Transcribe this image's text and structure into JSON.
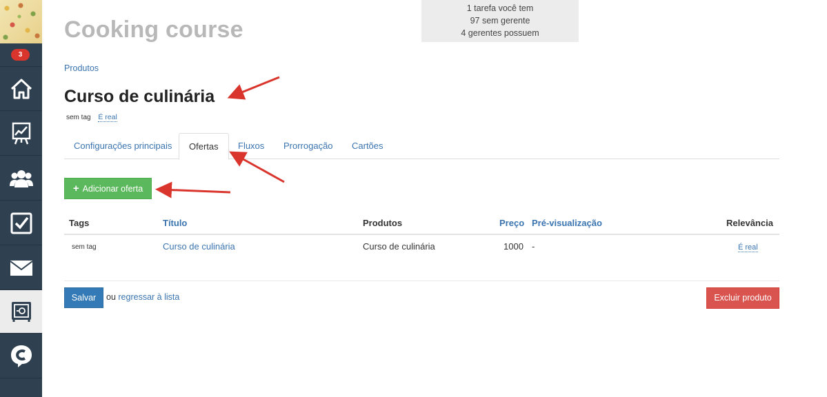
{
  "sidebar": {
    "notification_count": "3",
    "items": [
      {
        "name": "home"
      },
      {
        "name": "stats"
      },
      {
        "name": "users"
      },
      {
        "name": "tasks"
      },
      {
        "name": "mail"
      },
      {
        "name": "products",
        "active": true
      },
      {
        "name": "chat"
      }
    ]
  },
  "info_box": {
    "line1": "1 tarefa você tem",
    "line2": "97 sem gerente",
    "line3": "4 gerentes possuem"
  },
  "header": {
    "course_title": "Cooking course",
    "breadcrumb": "Produtos",
    "page_title": "Curso de culinária",
    "tag": "sem tag",
    "real_link": "É real"
  },
  "tabs": [
    {
      "label": "Configurações principais"
    },
    {
      "label": "Ofertas",
      "active": true
    },
    {
      "label": "Fluxos"
    },
    {
      "label": "Prorrogação"
    },
    {
      "label": "Cartões"
    }
  ],
  "add_offer_label": "Adicionar oferta",
  "table": {
    "columns": [
      "Tags",
      "Título",
      "Produtos",
      "Preço",
      "Pré-visualização",
      "Relevância"
    ],
    "rows": [
      {
        "tags": "sem tag",
        "title": "Curso de culinária",
        "products": "Curso de culinária",
        "price": "1000",
        "preview": "-",
        "relevance": "É real"
      }
    ]
  },
  "footer": {
    "save_label": "Salvar",
    "or_text": "ou",
    "back_link": "regressar à lista",
    "delete_label": "Excluir produto"
  },
  "colors": {
    "sidebar": "#2f4050",
    "link": "#3a74b0",
    "success": "#5cb85c",
    "primary": "#337ab7",
    "danger": "#d9534f",
    "annotation_arrow": "#d9352c"
  }
}
